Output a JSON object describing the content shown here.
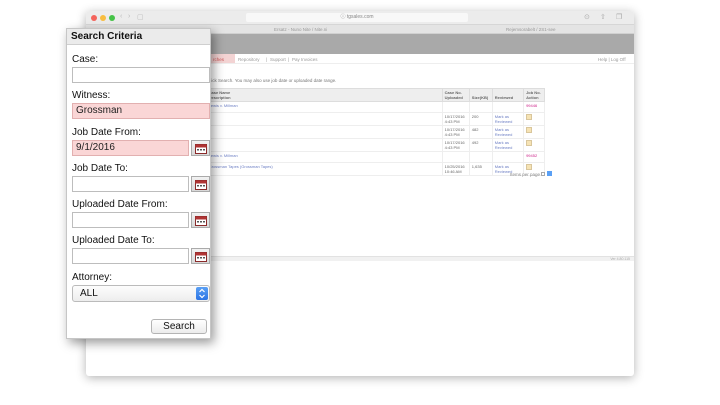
{
  "browser": {
    "url": "ⓘ tgsales.com",
    "tab_left": "Ersatz - Nuno Nite / Nite.ni",
    "tab_right": "Rejemsorabelt / 2S1-see"
  },
  "site": {
    "nav": [
      "rches",
      "Repository",
      "Support",
      "Pay Invoices"
    ],
    "help_links": "Help | Log Off",
    "instruction": "of the case name (or witness name), then click Search. You may also use job date or uploaded date range.",
    "columns": {
      "job_date": "Job Date:",
      "file_type": "File Type",
      "case_name": "Case Name",
      "description": "Description",
      "case_no": "Case No.",
      "uploaded": "Uploaded",
      "size": "Size(KB)",
      "reviewed": "Reviewed",
      "job_no": "Job No.",
      "action": "Action"
    },
    "rows": [
      {
        "left": "",
        "job_date": "10/14/2016",
        "file_type": "",
        "case": "Lewis v. Millman",
        "uploaded": "",
        "size": "",
        "reviewed": "",
        "job": "99446",
        "action": false
      },
      {
        "left": "– Bibb Grey",
        "job_date": "",
        "file_type": "ASCII .txt File",
        "case": "",
        "uploaded": "10/17/2016 4:43 PM",
        "size": "200",
        "reviewed": "Mark as Reviewed",
        "job": "",
        "action": true
      },
      {
        "left": "– Bibb Grey",
        "job_date": "",
        "file_type": "PDF Compressed Transcript",
        "case": "",
        "uploaded": "10/17/2016 4:43 PM",
        "size": "482",
        "reviewed": "Mark as Reviewed",
        "job": "",
        "action": true
      },
      {
        "left": "– Bibb Grey",
        "job_date": "",
        "file_type": "PDF Transcript",
        "case": "",
        "uploaded": "10/17/2016 4:43 PM",
        "size": "492",
        "reviewed": "Mark as Reviewed",
        "job": "",
        "action": true
      },
      {
        "left": "",
        "job_date": "10/19/2016",
        "file_type": "",
        "case": "Lewis v. Millman",
        "uploaded": "",
        "size": "",
        "reviewed": "",
        "job": "99452",
        "action": false
      },
      {
        "left": "",
        "job_date": "",
        "file_type": "",
        "case": "Grossman Tapes (Grossman Tapes)",
        "uploaded": "10/25/2016 10:46 AM",
        "size": "1,635",
        "reviewed": "Mark as Reviewed",
        "job": "",
        "action": true
      }
    ],
    "pager": "ems in 1 Pages)",
    "per_page": "Items per page",
    "footer": "Ver 4.80.115"
  },
  "panel": {
    "title": "Search Criteria",
    "case_label": "Case:",
    "case_value": "",
    "witness_label": "Witness:",
    "witness_value": "Grossman",
    "job_from_label": "Job Date From:",
    "job_from_value": "9/1/2016",
    "job_to_label": "Job Date To:",
    "job_to_value": "",
    "up_from_label": "Uploaded Date From:",
    "up_from_value": "",
    "up_to_label": "Uploaded Date To:",
    "up_to_value": "",
    "attorney_label": "Attorney:",
    "attorney_value": "ALL",
    "search_label": "Search"
  },
  "colors": {
    "highlight": "#fad6d6",
    "header_band": "#a9a9a9",
    "link": "#6d7fc4"
  }
}
